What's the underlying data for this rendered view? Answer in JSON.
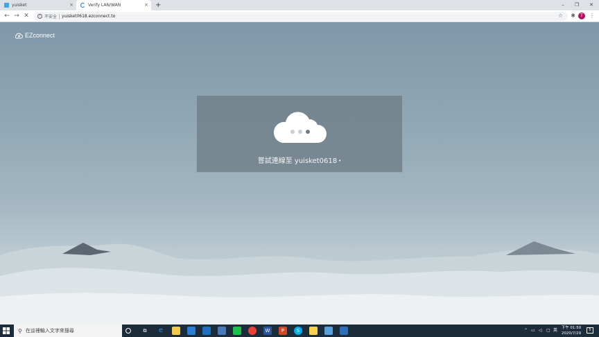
{
  "tabs": [
    {
      "title": "yuisket",
      "close": "×"
    },
    {
      "title": "Verify LAN/WAN",
      "close": "×"
    }
  ],
  "new_tab": "+",
  "window_controls": {
    "minimize": "–",
    "maximize": "❐",
    "close": "✕"
  },
  "toolbar": {
    "back": "←",
    "forward": "→",
    "stop": "✕",
    "info_glyph": "i",
    "insecure_label": "不安全",
    "url": "yuisket0618.ezconnect.to",
    "star": "☆",
    "extensions": "✱",
    "profile_initial": "T",
    "menu": "⋮"
  },
  "page": {
    "brand": "EZconnect",
    "status_text": "嘗試連線至 yuisket0618",
    "status_dot": "•"
  },
  "taskbar": {
    "search_placeholder": "在這裡輸入文字來搜尋",
    "clock_time": "下午 01:50",
    "clock_date": "2020/7/29",
    "ime": "英",
    "notifications": "5"
  },
  "colors": {
    "accent_profile": "#b3125c",
    "taskbar": "#1d2c3b"
  }
}
